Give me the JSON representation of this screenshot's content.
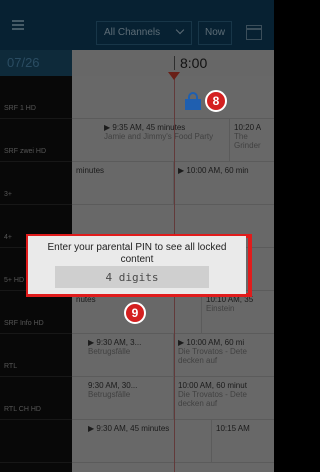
{
  "toolbar": {
    "channel_select": "All Channels",
    "now_label": "Now"
  },
  "header": {
    "date": "07/26",
    "time": "8:00"
  },
  "channels": [
    {
      "name": "SRF 1 HD"
    },
    {
      "name": "SRF zwei HD"
    },
    {
      "name": "3+"
    },
    {
      "name": "4+"
    },
    {
      "name": "5+ HD"
    },
    {
      "name": "SRF Info HD"
    },
    {
      "name": "RTL"
    },
    {
      "name": "RTL CH HD"
    },
    {
      "name": ""
    }
  ],
  "programs": [
    [],
    [
      {
        "time": "▶ 9:35 AM, 45 minutes",
        "title": "Jamie and Jimmy's Food Party"
      },
      {
        "time": "10:20 A",
        "title": "The Grinder"
      }
    ],
    [
      {
        "time": "minutes",
        "title": ""
      },
      {
        "time": "▶ 10:00 AM, 60 min",
        "title": ""
      }
    ],
    [],
    [],
    [
      {
        "time": "nutes",
        "title": ""
      },
      {
        "time": "10:10 AM, 35",
        "title": "Einstein"
      }
    ],
    [
      {
        "time": "▶ 9:30 AM, 3...",
        "title": "Betrugsfälle"
      },
      {
        "time": "▶ 10:00 AM, 60 mi",
        "title": "Die Trovatos - Dete decken auf"
      }
    ],
    [
      {
        "time": "9:30 AM, 30...",
        "title": "Betrugsfälle"
      },
      {
        "time": "10:00 AM, 60 minut",
        "title": "Die Trovatos - Dete decken auf"
      }
    ],
    [
      {
        "time": "▶ 9:30 AM, 45 minutes",
        "title": ""
      },
      {
        "time": "10:15 AM",
        "title": ""
      }
    ]
  ],
  "dialog": {
    "message": "Enter your parental PIN to see all locked content",
    "pin_placeholder": "4 digits"
  },
  "badges": {
    "lock_badge": "8",
    "dialog_badge": "9"
  },
  "colors": {
    "accent_red": "#e01c1c",
    "lock_blue": "#1f5fb0",
    "toolbar_bg": "#0d3d5b"
  }
}
